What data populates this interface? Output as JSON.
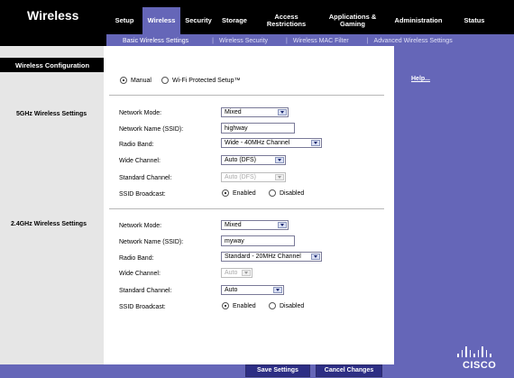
{
  "page": {
    "title": "Wireless"
  },
  "top_tabs": [
    {
      "label": "Setup",
      "active": false
    },
    {
      "label": "Wireless",
      "active": true
    },
    {
      "label": "Security",
      "active": false
    },
    {
      "label": "Storage",
      "active": false
    },
    {
      "label": "Access Restrictions",
      "active": false
    },
    {
      "label": "Applications & Gaming",
      "active": false
    },
    {
      "label": "Administration",
      "active": false
    },
    {
      "label": "Status",
      "active": false
    }
  ],
  "sub_nav": [
    {
      "label": "Basic Wireless Settings",
      "active": true
    },
    {
      "label": "Wireless Security",
      "active": false
    },
    {
      "label": "Wireless MAC Filter",
      "active": false
    },
    {
      "label": "Advanced Wireless Settings",
      "active": false
    }
  ],
  "sidebar": {
    "section_header": "Wireless Configuration",
    "section_5ghz": "5GHz Wireless Settings",
    "section_24ghz": "2.4GHz Wireless Settings"
  },
  "config_mode": {
    "manual": "Manual",
    "wps": "Wi-Fi Protected Setup™",
    "selected": "manual"
  },
  "labels": {
    "network_mode": "Network Mode:",
    "network_name": "Network Name (SSID):",
    "radio_band": "Radio Band:",
    "wide_channel": "Wide Channel:",
    "standard_channel": "Standard Channel:",
    "ssid_broadcast": "SSID Broadcast:",
    "enabled": "Enabled",
    "disabled": "Disabled"
  },
  "band_5ghz": {
    "network_mode": "Mixed",
    "ssid": "highway",
    "radio_band": "Wide - 40MHz Channel",
    "wide_channel": "Auto (DFS)",
    "standard_channel": "Auto (DFS)",
    "standard_channel_disabled": true,
    "ssid_broadcast": "enabled"
  },
  "band_24ghz": {
    "network_mode": "Mixed",
    "ssid": "myway",
    "radio_band": "Standard - 20MHz Channel",
    "wide_channel": "Auto",
    "wide_channel_disabled": true,
    "standard_channel": "Auto",
    "ssid_broadcast": "enabled"
  },
  "help": {
    "label": "Help..."
  },
  "buttons": {
    "save": "Save Settings",
    "cancel": "Cancel Changes"
  },
  "brand": {
    "logo_text": "CISCO"
  },
  "colors": {
    "accent": "#6566b8",
    "header": "#000000",
    "button": "#2d2e84",
    "sidebar": "#e6e6e6"
  }
}
